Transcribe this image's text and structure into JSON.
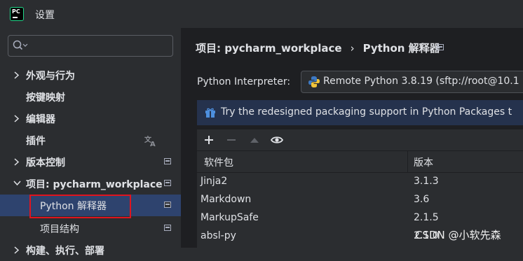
{
  "window": {
    "title": "设置"
  },
  "search": {
    "placeholder": ""
  },
  "sidebar": {
    "items": [
      {
        "label": "外观与行为"
      },
      {
        "label": "按键映射"
      },
      {
        "label": "编辑器"
      },
      {
        "label": "插件"
      },
      {
        "label": "版本控制"
      },
      {
        "label": "项目: pycharm_workplace"
      },
      {
        "label": "Python 解释器"
      },
      {
        "label": "项目结构"
      },
      {
        "label": "构建、执行、部署"
      }
    ]
  },
  "breadcrumb": {
    "parent": "项目: pycharm_workplace",
    "separator": "›",
    "current": "Python 解释器"
  },
  "interpreter": {
    "label": "Python Interpreter:",
    "value": "Remote Python 3.8.19 (sftp://root@10.1"
  },
  "banner": {
    "text": "Try the redesigned packaging support in Python Packages t"
  },
  "packages": {
    "headers": {
      "name": "软件包",
      "version": "版本"
    },
    "rows": [
      {
        "name": "Jinja2",
        "version": "3.1.3"
      },
      {
        "name": "Markdown",
        "version": "3.6"
      },
      {
        "name": "MarkupSafe",
        "version": "2.1.5"
      },
      {
        "name": "absl-py",
        "version": "2.1.0"
      }
    ]
  },
  "watermark": {
    "text": "CSDN @小软先森"
  },
  "colors": {
    "accent": "#2e436e",
    "highlight": "#e0141e",
    "banner": "#25324d"
  }
}
